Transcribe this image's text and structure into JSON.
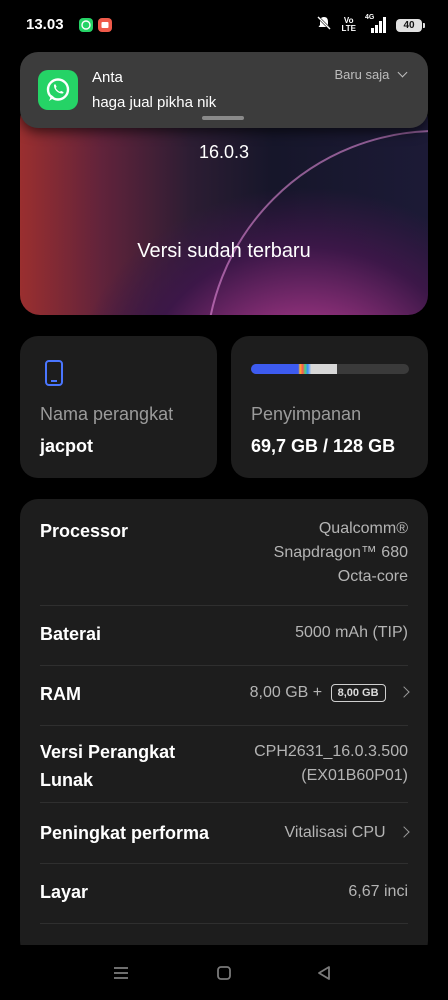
{
  "status_bar": {
    "time": "13.03",
    "volte_top": "Vo",
    "volte_bottom": "LTE",
    "network": "4G",
    "battery": "40",
    "icons": [
      "whatsapp-icon",
      "app-notification-icon",
      "mute-icon",
      "signal-icon",
      "battery-icon"
    ]
  },
  "notification": {
    "app": "Anta",
    "message": "haga jual pikha nik",
    "time": "Baru saja",
    "icon": "whatsapp-icon",
    "color": "#25d366"
  },
  "hero": {
    "version": "16.0.3",
    "status": "Versi sudah terbaru"
  },
  "device_card": {
    "label": "Nama perangkat",
    "value": "jacpot",
    "icon": "phone-icon"
  },
  "storage_card": {
    "label": "Penyimpanan",
    "value": "69,7 GB / 128 GB",
    "used_fraction": 0.545
  },
  "specs": {
    "processor": {
      "label": "Processor",
      "line1": "Qualcomm®",
      "line2": "Snapdragon™ 680",
      "line3": "Octa-core"
    },
    "battery": {
      "label": "Baterai",
      "value": "5000 mAh (TIP)"
    },
    "ram": {
      "label": "RAM",
      "value": "8,00 GB +",
      "badge": "8,00 GB"
    },
    "software": {
      "label_line1": "Versi Perangkat",
      "label_line2": "Lunak",
      "value_line1": "CPH2631_16.0.3.500",
      "value_line2": "(EX01B60P01)"
    },
    "performance": {
      "label": "Peningkat performa",
      "value": "Vitalisasi CPU"
    },
    "screen": {
      "label": "Layar",
      "value": "6,67 inci"
    }
  },
  "nav": {
    "icons": [
      "menu-icon",
      "home-icon",
      "back-icon"
    ]
  },
  "colors": {
    "background": "#000000",
    "card": "#1d1d1d",
    "storage_bar": "#3d5bf0",
    "accent_phone_icon": "#4a76ff"
  }
}
